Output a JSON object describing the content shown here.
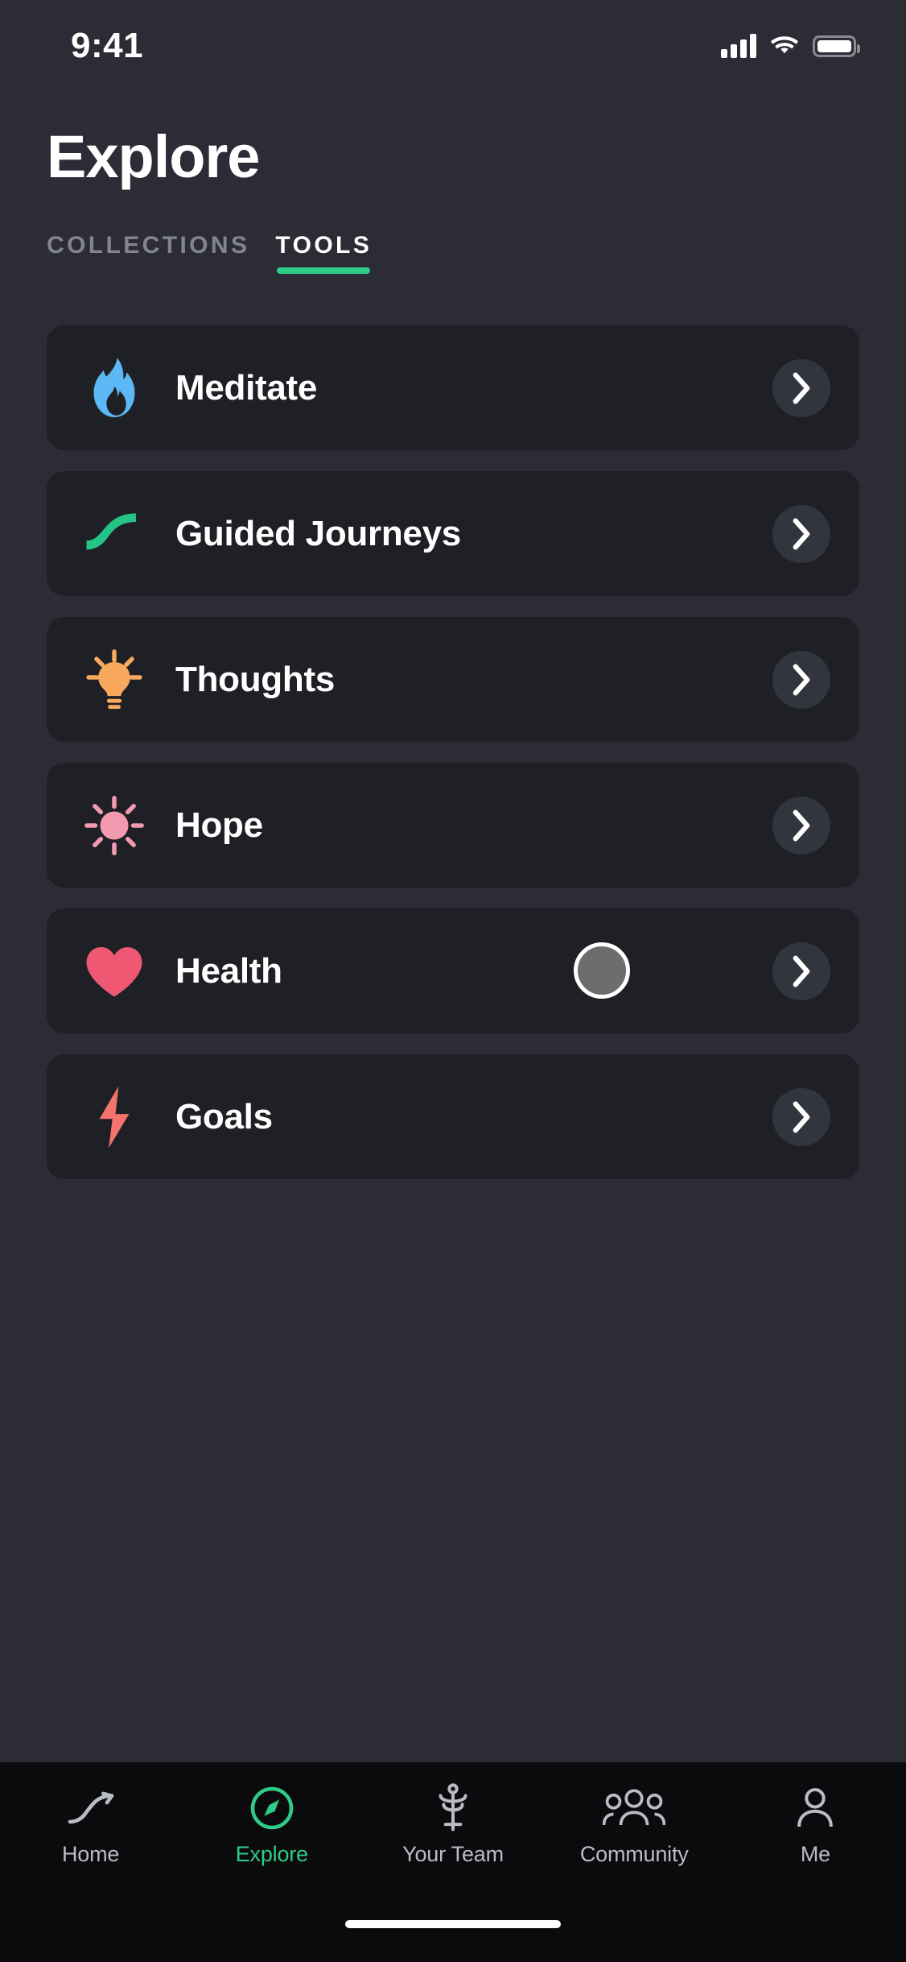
{
  "status_bar": {
    "time": "9:41",
    "signal_icon": "cellular-signal-icon",
    "wifi_icon": "wifi-icon",
    "battery_icon": "battery-icon"
  },
  "header": {
    "title": "Explore"
  },
  "tabs": [
    {
      "label": "COLLECTIONS",
      "active": false
    },
    {
      "label": "TOOLS",
      "active": true
    }
  ],
  "theme": {
    "page_bg": "#2b2c35",
    "card_bg": "#1e2025",
    "accent_green": "#2ecc87",
    "tab_inactive": "#82848f",
    "nav_bg": "#0b0b0d",
    "chevron_bg": "#33353e"
  },
  "tools": [
    {
      "label": "Meditate",
      "icon": "flame-icon",
      "color": "#5cb8f5"
    },
    {
      "label": "Guided Journeys",
      "icon": "path-curve-icon",
      "color": "#23c486"
    },
    {
      "label": "Thoughts",
      "icon": "lightbulb-icon",
      "color": "#f9a košice"
    },
    {
      "label": "Hope",
      "icon": "sun-icon",
      "color": "#f39ab0"
    },
    {
      "label": "Health",
      "icon": "heart-icon",
      "color": "#ef5872"
    },
    {
      "label": "Goals",
      "icon": "lightning-bolt-icon",
      "color": "#f4736b"
    }
  ],
  "chevron_label": "chevron-right-icon",
  "cursor": {
    "visible": true,
    "on_row": "Health"
  },
  "bottom_nav": [
    {
      "label": "Home",
      "icon": "path-curve-icon",
      "active": false
    },
    {
      "label": "Explore",
      "icon": "compass-icon",
      "active": true
    },
    {
      "label": "Your Team",
      "icon": "caduceus-icon",
      "active": false
    },
    {
      "label": "Community",
      "icon": "people-group-icon",
      "active": false
    },
    {
      "label": "Me",
      "icon": "person-icon",
      "active": false
    }
  ],
  "home_indicator": "home-indicator-bar"
}
